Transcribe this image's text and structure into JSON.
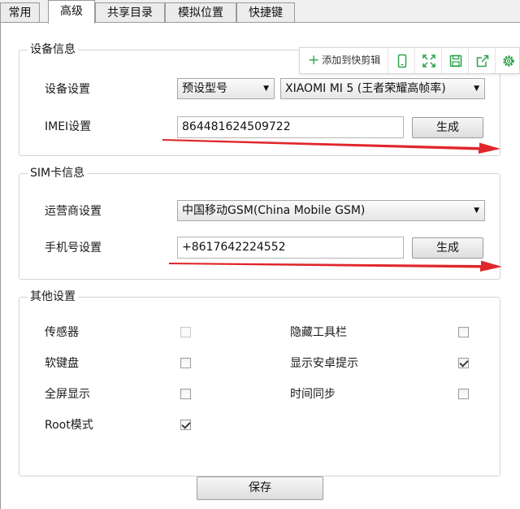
{
  "tabs": [
    {
      "label": "常用"
    },
    {
      "label": "高级"
    },
    {
      "label": "共享目录"
    },
    {
      "label": "模拟位置"
    },
    {
      "label": "快捷键"
    }
  ],
  "float_toolbar": {
    "add_label": "添加到快剪辑",
    "icons": [
      "phone-icon",
      "fullscreen-icon",
      "save-icon",
      "share-icon",
      "settings-icon"
    ],
    "accent_color": "#2aa24b"
  },
  "device_info": {
    "title": "设备信息",
    "device_label": "设备设置",
    "preset_select": "预设型号",
    "model_select": "XIAOMI MI 5 (王者荣耀高帧率)",
    "imei_label": "IMEI设置",
    "imei_value": "864481624509722",
    "generate_label": "生成"
  },
  "sim_info": {
    "title": "SIM卡信息",
    "carrier_label": "运营商设置",
    "carrier_select": "中国移动GSM(China Mobile GSM)",
    "phone_label": "手机号设置",
    "phone_value": "+8617642224552",
    "generate_label": "生成"
  },
  "other": {
    "title": "其他设置",
    "options": [
      {
        "label": "传感器",
        "checked": false,
        "disabled": true
      },
      {
        "label": "隐藏工具栏",
        "checked": false,
        "disabled": false
      },
      {
        "label": "软键盘",
        "checked": false,
        "disabled": false
      },
      {
        "label": "显示安卓提示",
        "checked": true,
        "disabled": false
      },
      {
        "label": "全屏显示",
        "checked": false,
        "disabled": false
      },
      {
        "label": "时间同步",
        "checked": false,
        "disabled": false
      },
      {
        "label": "Root模式",
        "checked": true,
        "disabled": false
      }
    ]
  },
  "save_label": "保存",
  "annotation_color": "#e0262b"
}
